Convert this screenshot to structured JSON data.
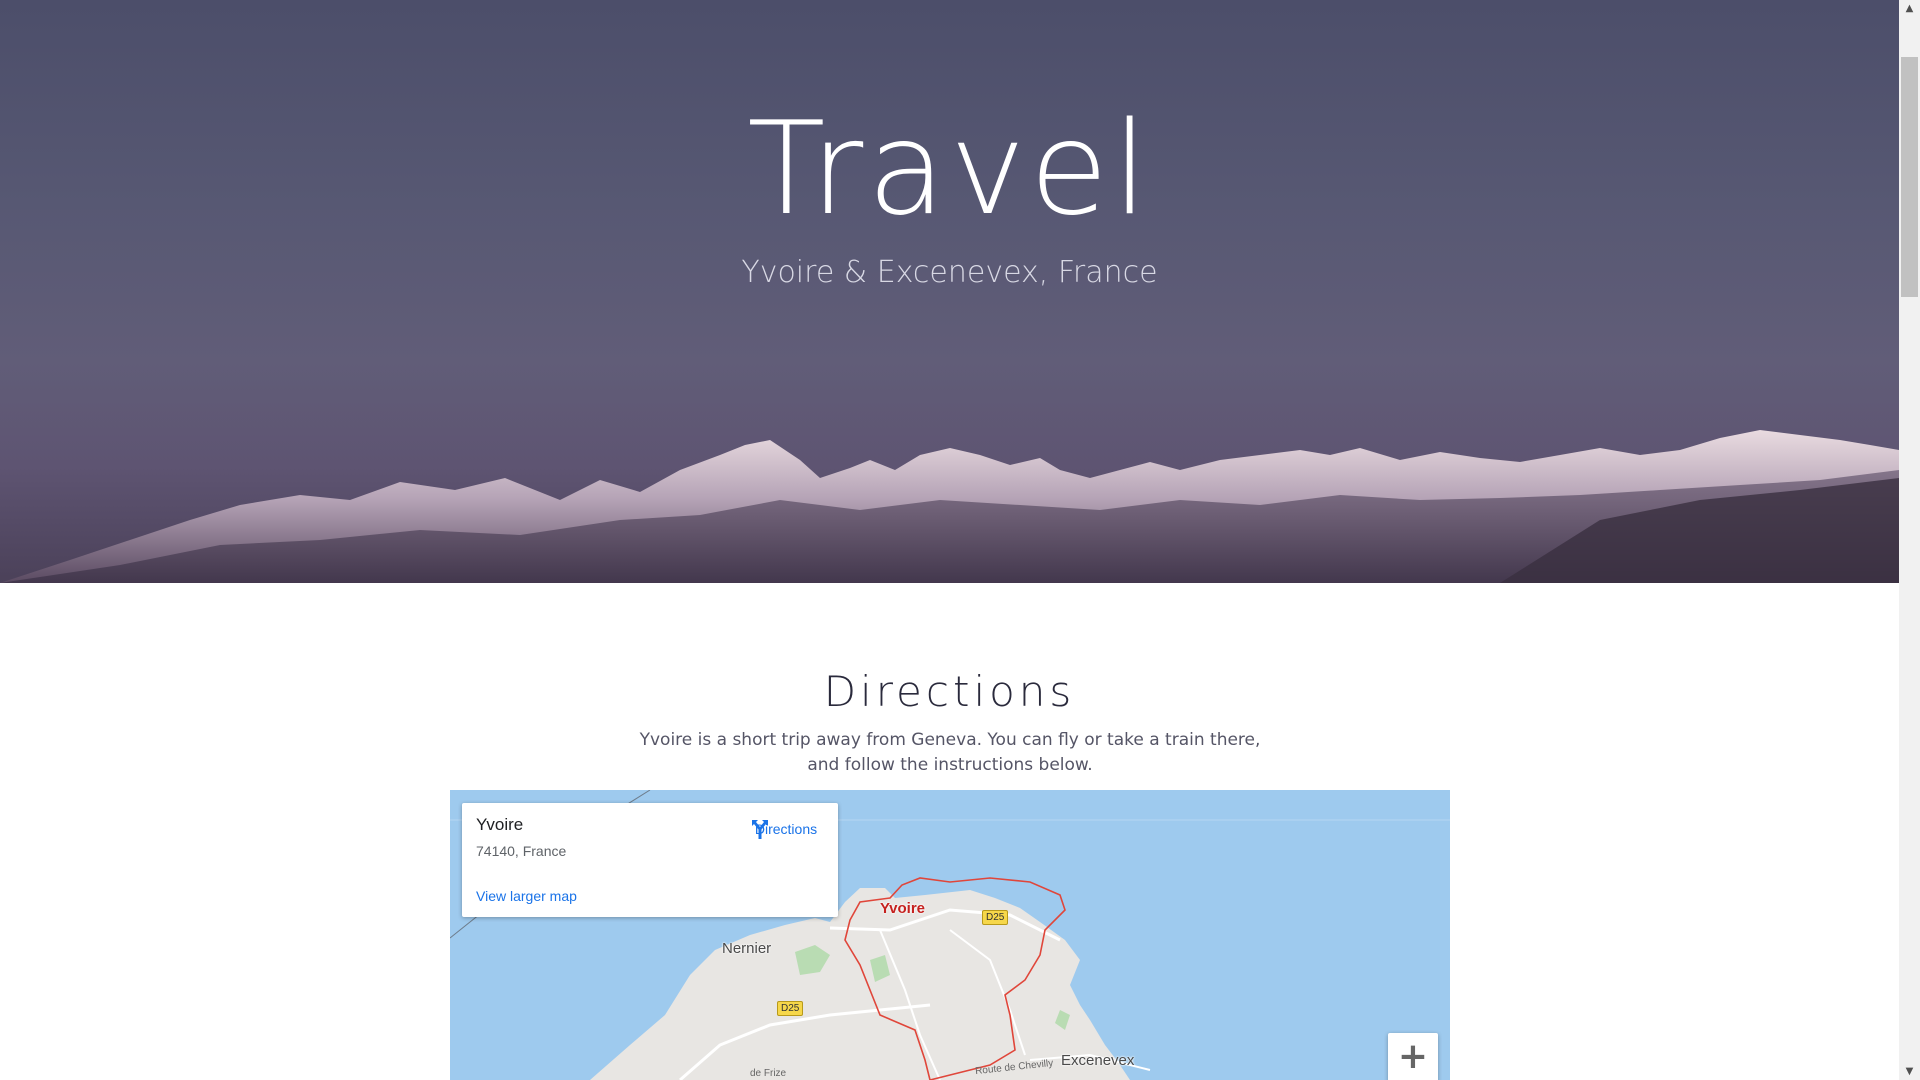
{
  "hero": {
    "title": "Travel",
    "subtitle": "Yvoire & Excenevex, France"
  },
  "directions": {
    "heading": "Directions",
    "line1": "Yvoire is a short trip away from Geneva. You can fly or take a train there,",
    "line2": "and follow the instructions below."
  },
  "map": {
    "place_name": "Yvoire",
    "address": "74140, France",
    "directions_label": "Directions",
    "larger_map_label": "View larger map",
    "zoom_in_label": "+",
    "labels": {
      "yvoire": "Yvoire",
      "nernier": "Nernier",
      "excenevex": "Excenevex",
      "road_d25_a": "D25",
      "road_d25_b": "D25",
      "road_frize": "de Frize",
      "road_chevilly": "Route de Chevilly"
    },
    "colors": {
      "water": "#9ecaee",
      "land": "#e8e6e3",
      "boundary": "#e0463a",
      "link": "#1a73e8"
    }
  },
  "scrollbar": {
    "up_arrow": "▲",
    "down_arrow": "▼"
  }
}
